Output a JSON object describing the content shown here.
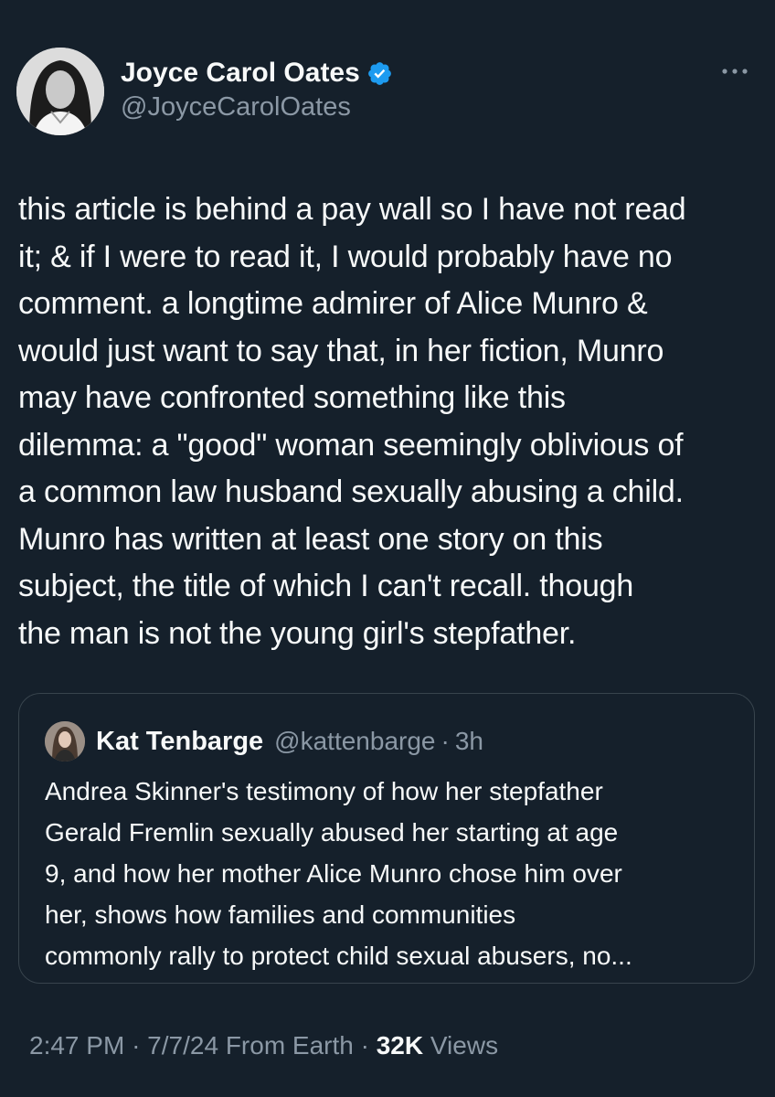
{
  "author": {
    "name": "Joyce Carol Oates",
    "handle": "@JoyceCarolOates",
    "verified": true
  },
  "tweet": {
    "lines": [
      "this article is behind a pay wall so I have not read",
      "it; & if I were to read it, I would probably have no",
      "comment. a longtime admirer of Alice Munro &",
      "would just want to say that, in her fiction, Munro",
      "may have confronted something like this",
      "dilemma: a \"good\" woman seemingly oblivious of",
      "a common law husband  sexually abusing a child.",
      "Munro has written at least one story on this",
      "subject, the title of which I can't recall. though",
      "the man is not the young girl's stepfather."
    ]
  },
  "quoted": {
    "name": "Kat Tenbarge",
    "handle": "@kattenbarge",
    "separator": "·",
    "time": "3h",
    "lines": [
      "Andrea Skinner's testimony of how her stepfather",
      "Gerald Fremlin sexually abused her starting at age",
      "9, and how her mother Alice Munro chose him over",
      "her, shows how families and communities",
      "commonly rally to protect child sexual abusers, no..."
    ]
  },
  "footer": {
    "time": "2:47 PM",
    "sep1": "·",
    "date": "7/7/24",
    "source": "From Earth",
    "sep2": "·",
    "views_count": "32K",
    "views_label": "Views"
  },
  "icons": {
    "verified": "verified-badge-icon",
    "more": "more-options-icon"
  },
  "colors": {
    "background": "#15202b",
    "text": "#f7f9f9",
    "secondary": "#8b98a5",
    "verified": "#1d9bf0",
    "border": "#38444d"
  }
}
